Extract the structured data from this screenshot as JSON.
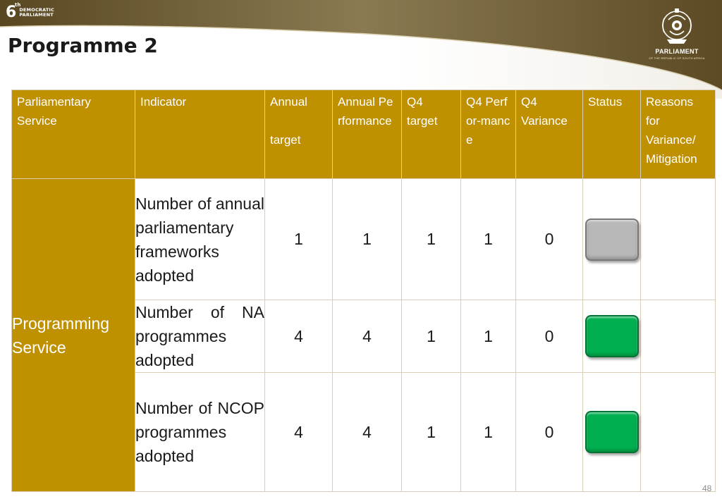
{
  "header": {
    "logo": {
      "numeral": "6",
      "superscript": "th",
      "lines": [
        "DEMOCRATIC",
        "PARLIAMENT"
      ]
    },
    "title": "Programme 2",
    "parliament_logo": {
      "name": "PARLIAMENT",
      "subtitle": "OF THE REPUBLIC OF SOUTH AFRICA"
    }
  },
  "colors": {
    "banner": "#6e5a2c",
    "table_header": "#bf9000",
    "status_grey": "#b8b8b8",
    "status_green": "#00b050"
  },
  "table": {
    "columns": [
      "Parliamentary Service",
      "Indicator",
      "Annual\n\ntarget",
      "Annual Performance",
      "Q4 target",
      "Q4 Perfor-mance",
      "Q4 Variance",
      "Status",
      "Reasons for Variance/ Mitigation"
    ],
    "row_group": "Programming Service",
    "rows": [
      {
        "indicator": "Number of annual parliamentary frameworks adopted",
        "annual_target": "1",
        "annual_performance": "1",
        "q4_target": "1",
        "q4_performance": "1",
        "q4_variance": "0",
        "status": "grey",
        "reasons": ""
      },
      {
        "indicator": "Number of NA programmes adopted",
        "annual_target": "4",
        "annual_performance": "4",
        "q4_target": "1",
        "q4_performance": "1",
        "q4_variance": "0",
        "status": "green",
        "reasons": ""
      },
      {
        "indicator": "Number of NCOP programmes adopted",
        "annual_target": "4",
        "annual_performance": "4",
        "q4_target": "1",
        "q4_performance": "1",
        "q4_variance": "0",
        "status": "green",
        "reasons": ""
      }
    ]
  },
  "footer": {
    "page_number": "48"
  }
}
